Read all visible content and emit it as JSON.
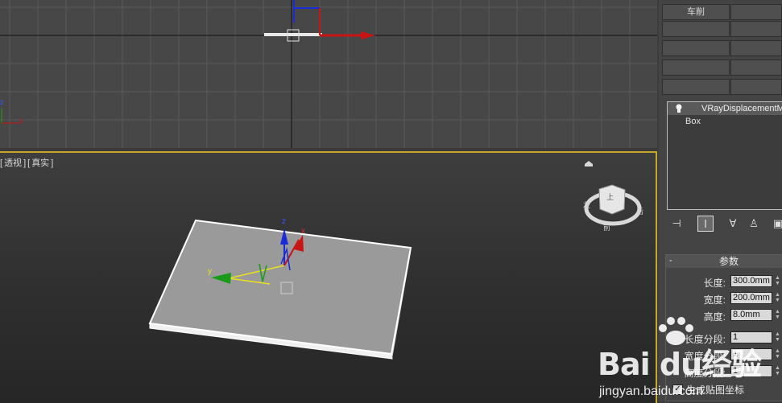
{
  "top_panel_buttons": [
    "车削"
  ],
  "modifier_stack": {
    "items": [
      "VRayDisplacementMod",
      "Box"
    ]
  },
  "viewport": {
    "label_parts": [
      "[",
      "透视",
      "]",
      "[",
      "真实",
      "]"
    ],
    "axis_labels": {
      "x": "x",
      "y": "y",
      "z": "z"
    }
  },
  "parameters": {
    "title": "参数",
    "collapse_symbol": "-",
    "length_label": "长度:",
    "length_value": "300.0mm",
    "width_label": "宽度:",
    "width_value": "200.0mm",
    "height_label": "高度:",
    "height_value": "8.0mm",
    "length_segs_label": "长度分段:",
    "length_segs_value": "1",
    "width_segs_label": "宽度分段:",
    "width_segs_value": "1",
    "height_segs_label": "高度分段:",
    "height_segs_value": "1",
    "gen_map_label": "生成贴图坐标",
    "gen_map_checked": true
  },
  "viewcube_labels": {
    "left": "左",
    "right": "后",
    "bottom": "前"
  },
  "watermark": {
    "brand": "Bai du经验",
    "url": "jingyan.baidu.com"
  },
  "colors": {
    "active_viewport_border": "#c7a72a",
    "axis_x": "#c81414",
    "axis_y": "#e8e020",
    "axis_z": "#1a2cd8"
  }
}
